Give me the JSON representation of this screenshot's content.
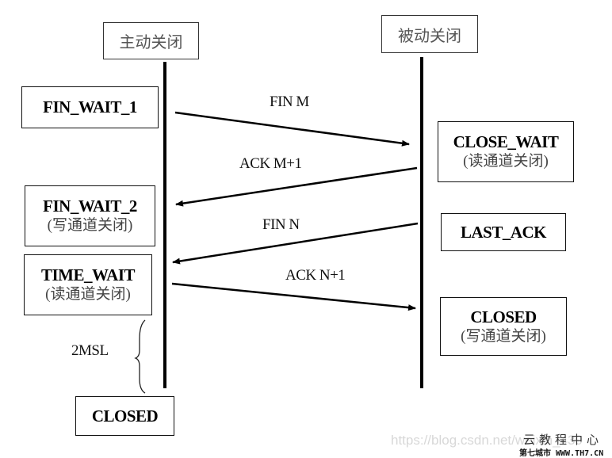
{
  "participants": {
    "active": "主动关闭",
    "passive": "被动关闭"
  },
  "active_states": [
    {
      "state": "FIN_WAIT_1",
      "note": ""
    },
    {
      "state": "FIN_WAIT_2",
      "note": "(写通道关闭)"
    },
    {
      "state": "TIME_WAIT",
      "note": "(读通道关闭)"
    },
    {
      "state": "CLOSED",
      "note": ""
    }
  ],
  "passive_states": [
    {
      "state": "CLOSE_WAIT",
      "note": "(读通道关闭)"
    },
    {
      "state": "LAST_ACK",
      "note": ""
    },
    {
      "state": "CLOSED",
      "note": "(写通道关闭)"
    }
  ],
  "messages": [
    {
      "label": "FIN M",
      "direction": "active-to-passive"
    },
    {
      "label": "ACK M+1",
      "direction": "passive-to-active"
    },
    {
      "label": "FIN N",
      "direction": "passive-to-active"
    },
    {
      "label": "ACK N+1",
      "direction": "active-to-passive"
    }
  ],
  "timer": {
    "label": "2MSL"
  },
  "watermark": {
    "url": "https://blog.csdn.net/weixin_439",
    "brand_cn": "云教程中心",
    "brand_small": "第七城市   WWW.TH7.CN"
  }
}
